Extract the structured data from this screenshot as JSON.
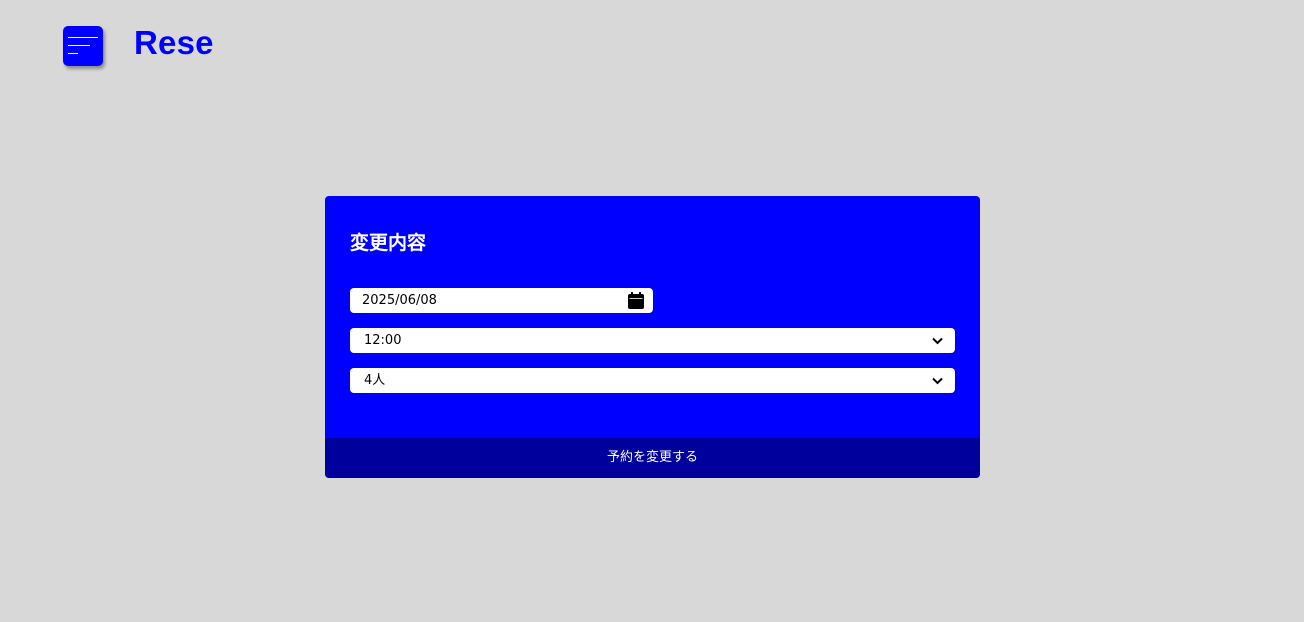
{
  "header": {
    "brand": "Rese",
    "menu_icon": "hamburger-menu-icon"
  },
  "colors": {
    "background": "#d8d8d8",
    "accent": "#0000ff",
    "button_dark": "#00009d",
    "text_on_accent": "#ffffff"
  },
  "card": {
    "title": "変更内容",
    "date": {
      "value": "2025/06/08",
      "icon": "calendar-icon"
    },
    "time": {
      "value": "12:00",
      "icon": "chevron-down-icon"
    },
    "people": {
      "value": "4人",
      "icon": "chevron-down-icon"
    },
    "submit_label": "予約を変更する"
  }
}
